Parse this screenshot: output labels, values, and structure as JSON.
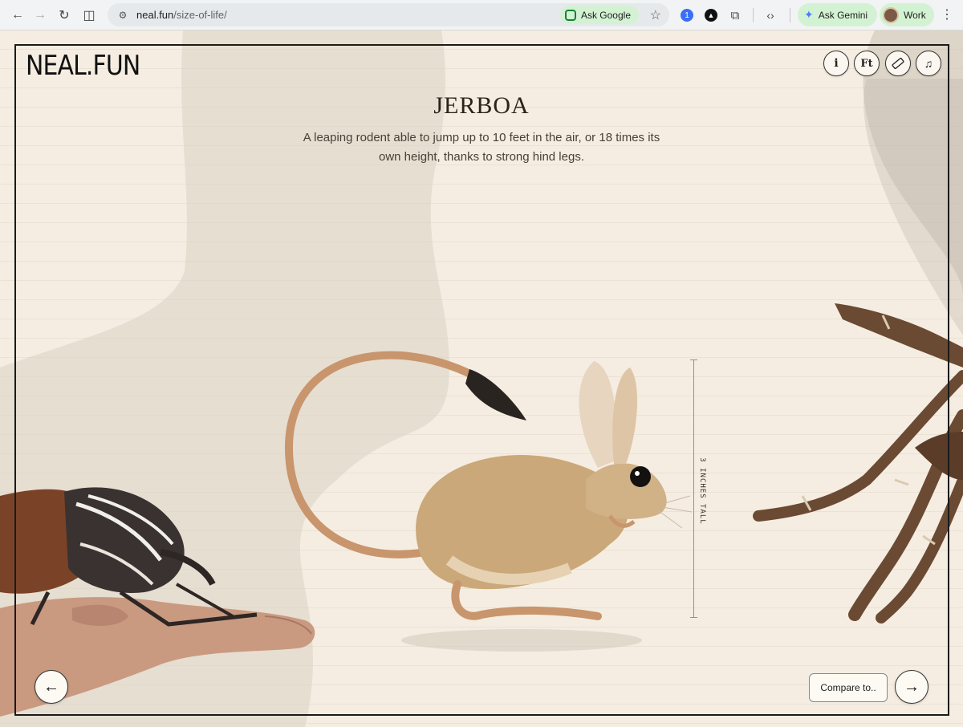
{
  "browser": {
    "url_host": "neal.fun",
    "url_path": "/size-of-life/",
    "ask_google_label": "Ask Google",
    "ask_gemini_label": "Ask Gemini",
    "profile_label": "Work"
  },
  "site": {
    "logo": "NEAL.FUN"
  },
  "toolbar": {
    "info_icon": "info-icon",
    "units_label": "Ft",
    "ruler_icon": "ruler-icon",
    "music_icon": "music-icon"
  },
  "animal": {
    "name": "JERBOA",
    "description": "A leaping rodent able to jump up to 10 feet in the air, or 18 times its own height, thanks to strong hind legs.",
    "height_label": "3 INCHES TALL"
  },
  "controls": {
    "compare_label": "Compare to..",
    "prev_icon": "arrow-left-icon",
    "next_icon": "arrow-right-icon"
  }
}
